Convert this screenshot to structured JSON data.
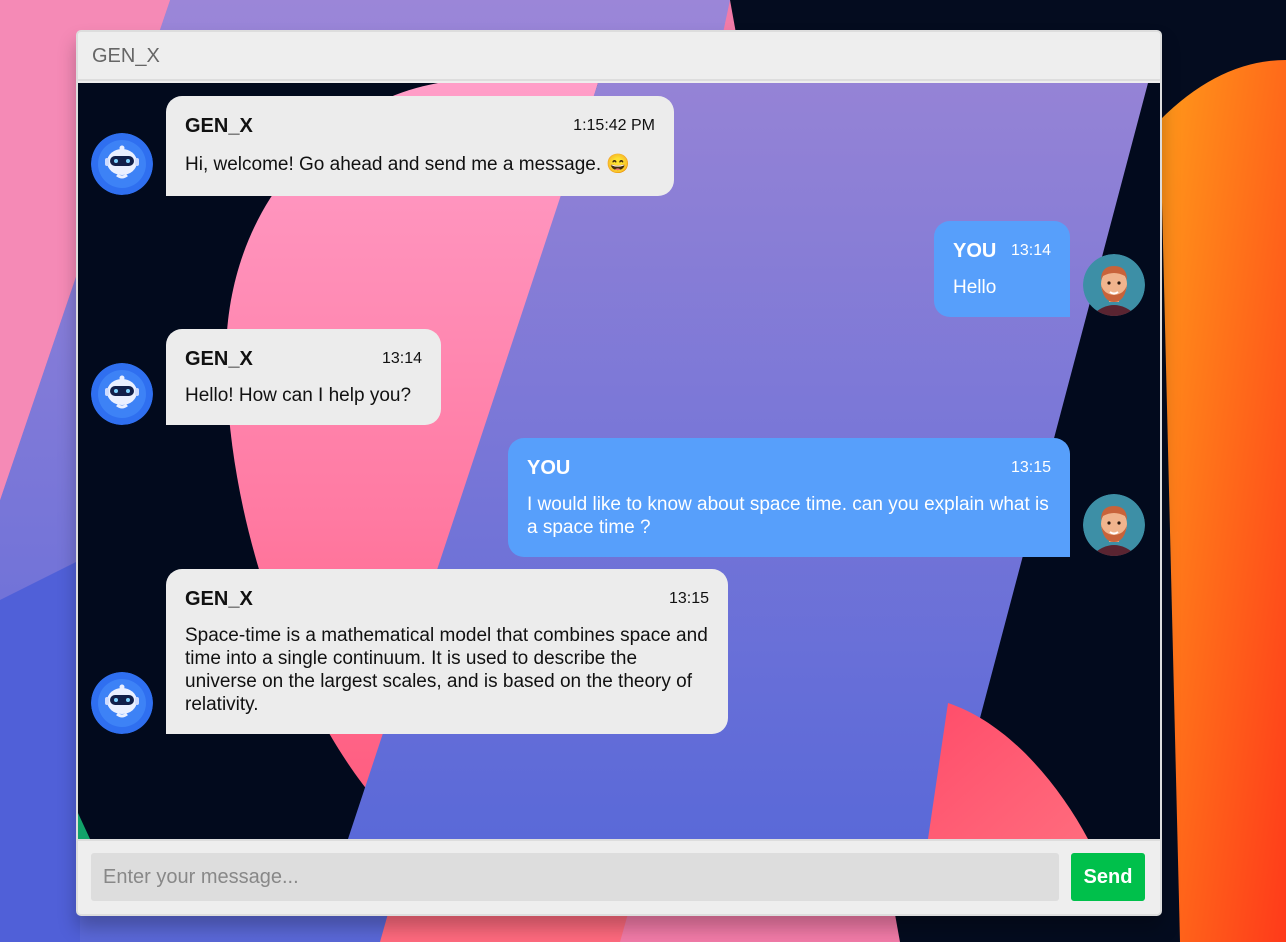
{
  "window": {
    "title": "GEN_X"
  },
  "colors": {
    "bot_bubble": "#ececec",
    "user_bubble": "#579ffb",
    "send_button": "#00c04b",
    "chat_background": "#020a1d"
  },
  "messages": [
    {
      "sender": "bot",
      "name": "GEN_X",
      "time": "1:15:42 PM",
      "text": "Hi, welcome! Go ahead and send me a message. 😄",
      "avatar_icon": "robot-avatar-icon"
    },
    {
      "sender": "user",
      "name": "YOU",
      "time": "13:14",
      "text": "Hello",
      "avatar_icon": "user-avatar-icon"
    },
    {
      "sender": "bot",
      "name": "GEN_X",
      "time": "13:14",
      "text": "Hello! How can I help you?",
      "avatar_icon": "robot-avatar-icon"
    },
    {
      "sender": "user",
      "name": "YOU",
      "time": "13:15",
      "text": "I would like to know about space time. can you explain what is a space time ?",
      "avatar_icon": "user-avatar-icon"
    },
    {
      "sender": "bot",
      "name": "GEN_X",
      "time": "13:15",
      "text": "Space-time is a mathematical model that combines space and time into a single continuum. It is used to describe the universe on the largest scales, and is based on the theory of relativity.",
      "avatar_icon": "robot-avatar-icon"
    }
  ],
  "composer": {
    "placeholder": "Enter your message...",
    "value": "",
    "send_label": "Send"
  }
}
